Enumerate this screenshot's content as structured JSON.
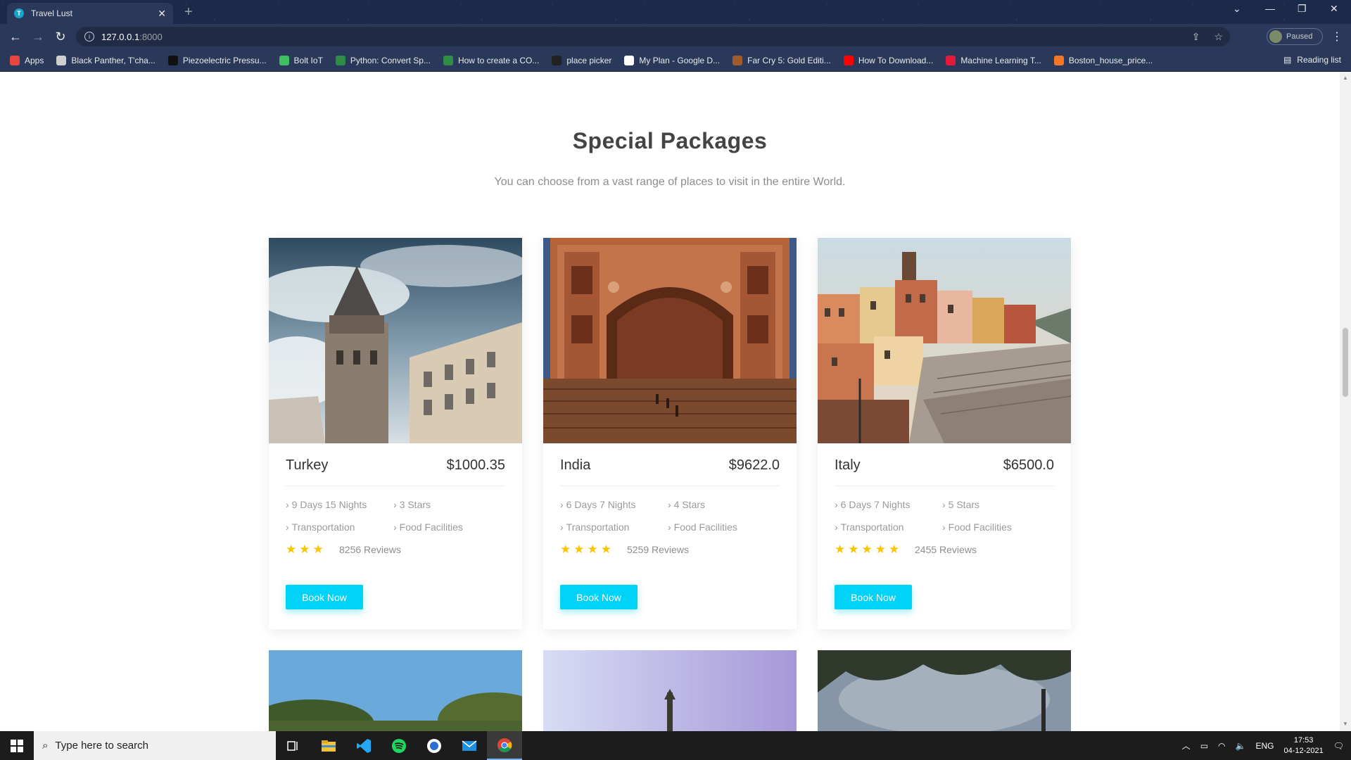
{
  "browser": {
    "tab_title": "Travel Lust",
    "tab_favicon_letter": "T",
    "url_host": "127.0.0.1",
    "url_port": ":8000",
    "profile_status": "Paused"
  },
  "bookmarks": {
    "items": [
      {
        "label": "Apps",
        "icon": "apps-grid-icon",
        "color": "#e8453c"
      },
      {
        "label": "Black Panther, T'cha...",
        "icon": "black-panther-icon",
        "color": "#cfcfcf"
      },
      {
        "label": "Piezoelectric Pressu...",
        "icon": "piezo-icon",
        "color": "#111111"
      },
      {
        "label": "Bolt IoT",
        "icon": "bolt-iot-icon",
        "color": "#3fbf62"
      },
      {
        "label": "Python: Convert Sp...",
        "icon": "geeks-icon",
        "color": "#2f8d46"
      },
      {
        "label": "How to create a CO...",
        "icon": "geeks-icon",
        "color": "#2f8d46"
      },
      {
        "label": "place picker",
        "icon": "github-icon",
        "color": "#222222"
      },
      {
        "label": "My Plan - Google D...",
        "icon": "google-icon",
        "color": "#ffffff"
      },
      {
        "label": "Far Cry 5: Gold Editi...",
        "icon": "farcry-icon",
        "color": "#a05a2c"
      },
      {
        "label": "How To Download...",
        "icon": "youtube-icon",
        "color": "#ff0000"
      },
      {
        "label": "Machine Learning T...",
        "icon": "tesla-icon",
        "color": "#e31937"
      },
      {
        "label": "Boston_house_price...",
        "icon": "notebook-icon",
        "color": "#f37726"
      }
    ],
    "reading_list": "Reading list"
  },
  "section": {
    "title": "Special Packages",
    "subtitle": "You can choose from a vast range of places to visit in the entire World."
  },
  "packages": [
    {
      "country": "Turkey",
      "price": "$1000.35",
      "duration": "9 Days 15 Nights",
      "stars_label": "3 Stars",
      "transport": "Transportation",
      "food": "Food Facilities",
      "rating": 3,
      "stars_glyph": "★★★",
      "reviews": "8256 Reviews",
      "button": "Book Now"
    },
    {
      "country": "India",
      "price": "$9622.0",
      "duration": "6 Days 7 Nights",
      "stars_label": "4 Stars",
      "transport": "Transportation",
      "food": "Food Facilities",
      "rating": 4,
      "stars_glyph": "★★★★",
      "reviews": "5259 Reviews",
      "button": "Book Now"
    },
    {
      "country": "Italy",
      "price": "$6500.0",
      "duration": "6 Days 7 Nights",
      "stars_label": "5 Stars",
      "transport": "Transportation",
      "food": "Food Facilities",
      "rating": 5,
      "stars_glyph": "★★★★★",
      "reviews": "2455 Reviews",
      "button": "Book Now"
    }
  ],
  "colors": {
    "accent": "#00d2f8",
    "star": "#f7c600"
  },
  "taskbar": {
    "search_placeholder": "Type here to search",
    "language": "ENG",
    "time": "17:53",
    "date": "04-12-2021"
  }
}
